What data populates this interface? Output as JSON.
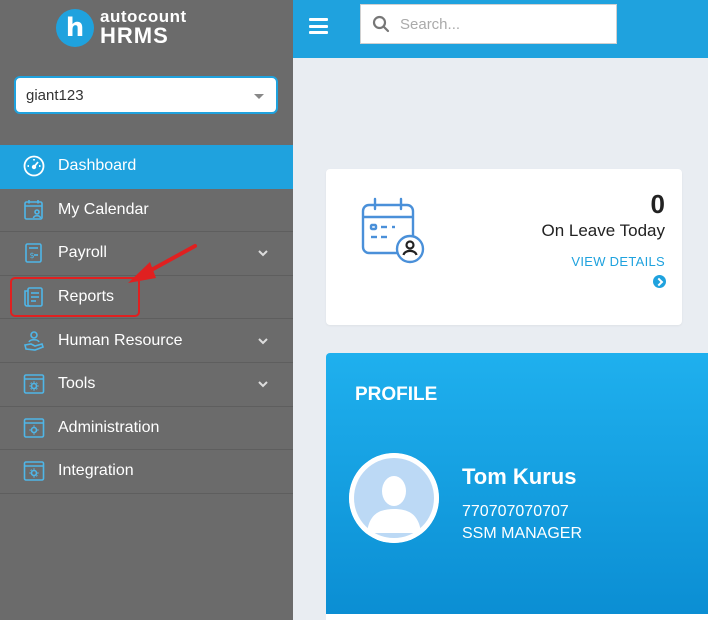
{
  "brand": {
    "badge_letter": "h",
    "name_top": "autocount",
    "name_bottom": "HRMS",
    "color": "#1fa2de"
  },
  "company_select": {
    "value": "giant123"
  },
  "search": {
    "placeholder": "Search..."
  },
  "sidebar": {
    "items": [
      {
        "label": "Dashboard",
        "icon": "dashboard-gauge-icon",
        "active": true,
        "has_submenu": false
      },
      {
        "label": "My Calendar",
        "icon": "calendar-user-icon",
        "active": false,
        "has_submenu": false
      },
      {
        "label": "Payroll",
        "icon": "payroll-icon",
        "active": false,
        "has_submenu": true
      },
      {
        "label": "Reports",
        "icon": "reports-icon",
        "active": false,
        "has_submenu": false
      },
      {
        "label": "Human Resource",
        "icon": "human-resource-icon",
        "active": false,
        "has_submenu": true
      },
      {
        "label": "Tools",
        "icon": "tools-gear-icon",
        "active": false,
        "has_submenu": true
      },
      {
        "label": "Administration",
        "icon": "administration-icon",
        "active": false,
        "has_submenu": false
      },
      {
        "label": "Integration",
        "icon": "integration-icon",
        "active": false,
        "has_submenu": false
      }
    ]
  },
  "leave_card": {
    "count": "0",
    "label": "On Leave Today",
    "link": "VIEW DETAILS"
  },
  "profile": {
    "title": "PROFILE",
    "name": "Tom Kurus",
    "id": "770707070707",
    "role": "SSM MANAGER"
  },
  "annotation": {
    "highlight_color": "#e02020"
  }
}
